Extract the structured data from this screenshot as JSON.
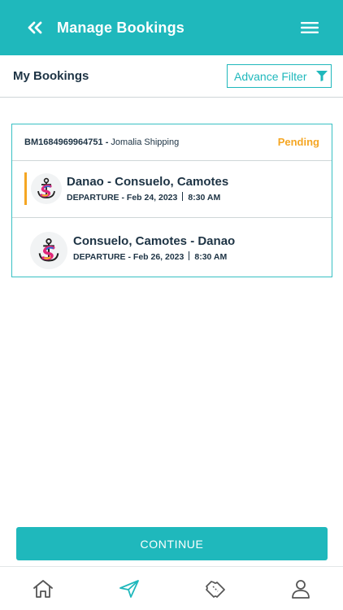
{
  "header": {
    "title": "Manage Bookings",
    "back_icon": "double-chevron-left-icon",
    "menu_icon": "hamburger-menu-icon",
    "color": "#1fb8bc"
  },
  "subbar": {
    "label": "My Bookings",
    "filter_label": "Advance Filter",
    "filter_icon": "funnel-icon"
  },
  "booking": {
    "reference": "BM1684969964751",
    "separator": " - ",
    "operator": "Jomalia Shipping",
    "status": "Pending",
    "status_color": "#f5a623",
    "trips": [
      {
        "route": "Danao - Consuelo, Camotes",
        "type_label": "DEPARTURE",
        "date": "Feb 24, 2023",
        "time": "8:30 AM"
      },
      {
        "route": "Consuelo, Camotes - Danao",
        "type_label": "DEPARTURE",
        "date": "Feb 26, 2023",
        "time": "8:30 AM"
      }
    ]
  },
  "continue_label": "CONTINUE",
  "tabs": [
    {
      "name": "home",
      "icon": "home-icon"
    },
    {
      "name": "send",
      "icon": "paper-plane-icon"
    },
    {
      "name": "tickets",
      "icon": "ticket-icon"
    },
    {
      "name": "profile",
      "icon": "user-icon"
    }
  ]
}
